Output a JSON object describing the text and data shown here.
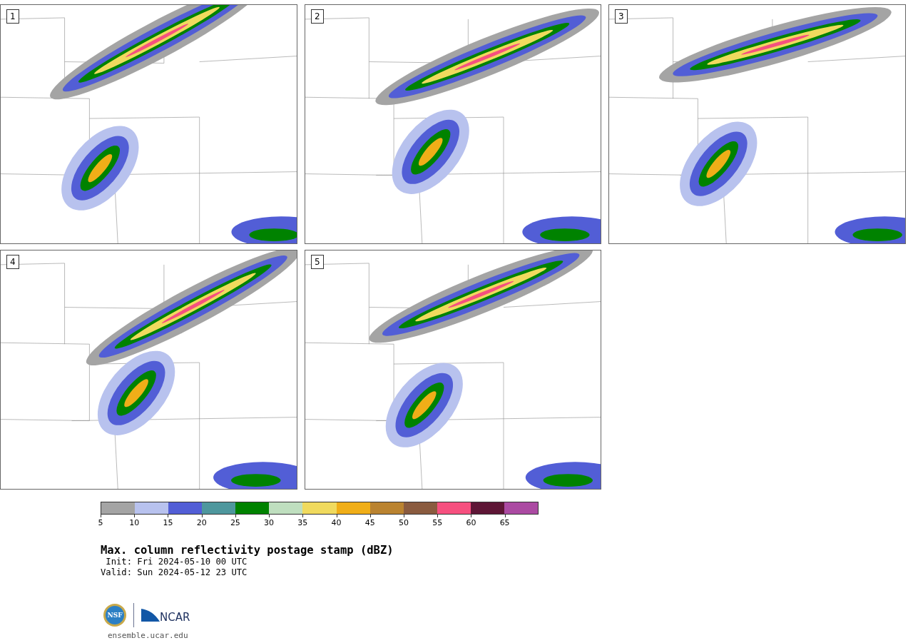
{
  "panels": [
    {
      "number": "1"
    },
    {
      "number": "2"
    },
    {
      "number": "3"
    },
    {
      "number": "4"
    },
    {
      "number": "5"
    }
  ],
  "colorbar": {
    "bins": [
      {
        "color": "#a4a4a4"
      },
      {
        "color": "#b8c2ee"
      },
      {
        "color": "#525ed6"
      },
      {
        "color": "#4e979d"
      },
      {
        "color": "#008200"
      },
      {
        "color": "#bfdfbf"
      },
      {
        "color": "#f0da5e"
      },
      {
        "color": "#f0ae18"
      },
      {
        "color": "#ba8330"
      },
      {
        "color": "#8a5b3f"
      },
      {
        "color": "#f6507f"
      },
      {
        "color": "#5e1636"
      },
      {
        "color": "#ab4aa2"
      }
    ],
    "ticks": [
      "5",
      "10",
      "15",
      "20",
      "25",
      "30",
      "35",
      "40",
      "45",
      "50",
      "55",
      "60",
      "65"
    ]
  },
  "title": "Max. column reflectivity postage stamp (dBZ)",
  "init": " Init: Fri 2024-05-10 00 UTC",
  "valid": "Valid: Sun 2024-05-12 23 UTC",
  "logos": {
    "left": "NSF",
    "right": "NCAR"
  },
  "url": "ensemble.ucar.edu"
}
